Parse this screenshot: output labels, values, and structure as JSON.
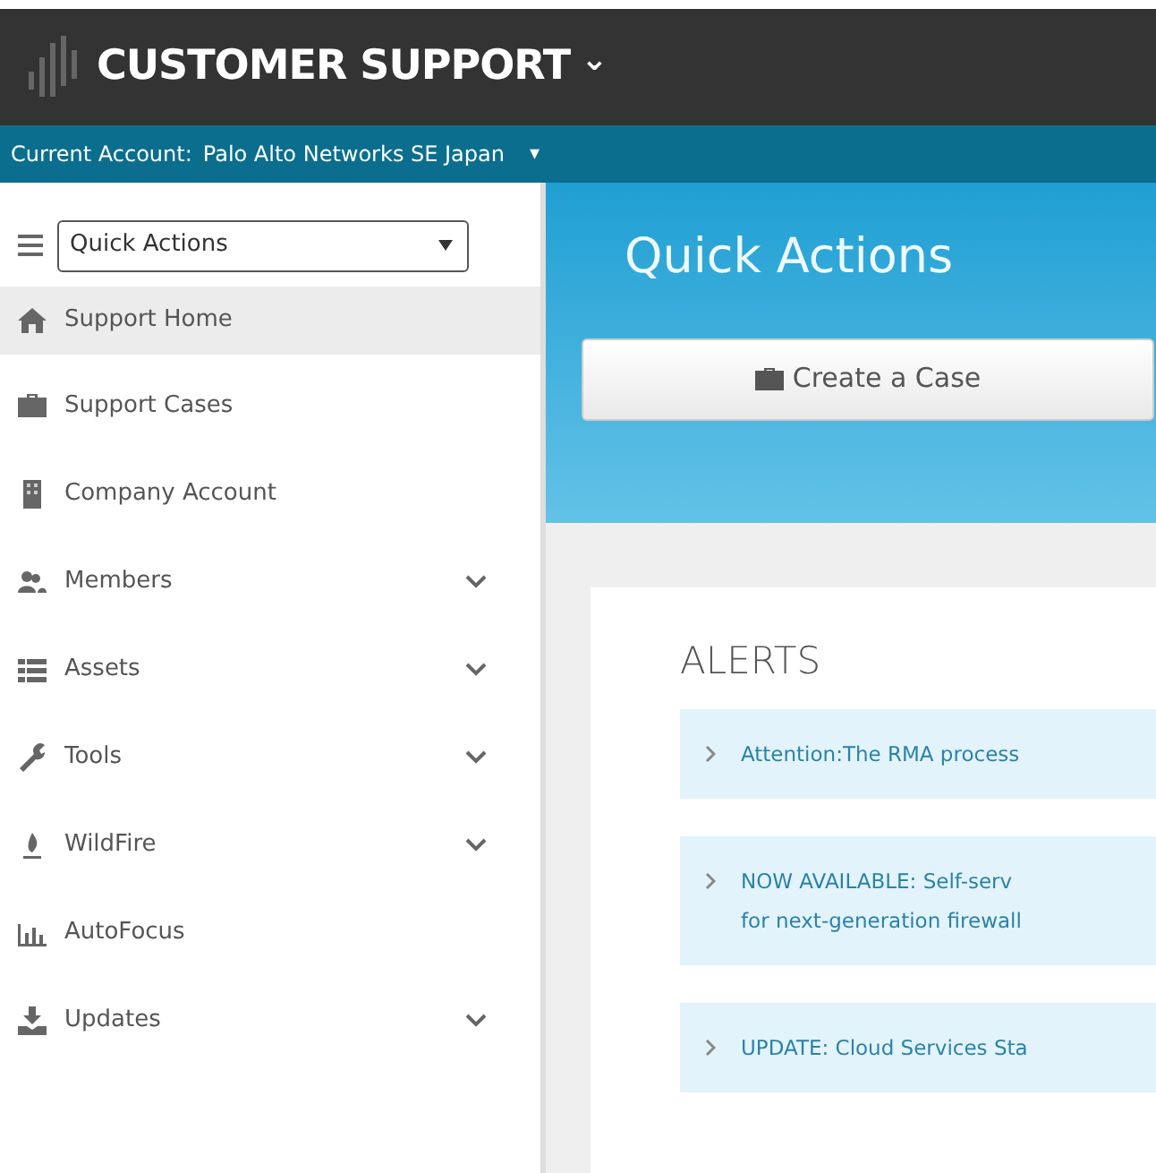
{
  "header": {
    "title": "CUSTOMER SUPPORT",
    "caret": "⌄"
  },
  "account_bar": {
    "label": "Current Account:",
    "account": "Palo Alto Networks SE Japan",
    "caret": "▾"
  },
  "sidebar": {
    "menu_select": {
      "value": "Quick Actions"
    },
    "items": [
      {
        "label": "Support Home",
        "selected": true,
        "expandable": false
      },
      {
        "label": "Support Cases",
        "selected": false,
        "expandable": false
      },
      {
        "label": "Company Account",
        "selected": false,
        "expandable": false
      },
      {
        "label": "Members",
        "selected": false,
        "expandable": true
      },
      {
        "label": "Assets",
        "selected": false,
        "expandable": true
      },
      {
        "label": "Tools",
        "selected": false,
        "expandable": true
      },
      {
        "label": "WildFire",
        "selected": false,
        "expandable": true
      },
      {
        "label": "AutoFocus",
        "selected": false,
        "expandable": false
      },
      {
        "label": "Updates",
        "selected": false,
        "expandable": true
      }
    ]
  },
  "quick_actions": {
    "title": "Quick Actions",
    "button": "Create a Case"
  },
  "alerts": {
    "title": "ALERTS",
    "items": [
      {
        "lines": [
          "Attention:The RMA process"
        ]
      },
      {
        "lines": [
          "NOW AVAILABLE: Self-serv",
          "for next-generation firewall"
        ]
      },
      {
        "lines": [
          "UPDATE: Cloud Services Sta"
        ]
      }
    ]
  }
}
